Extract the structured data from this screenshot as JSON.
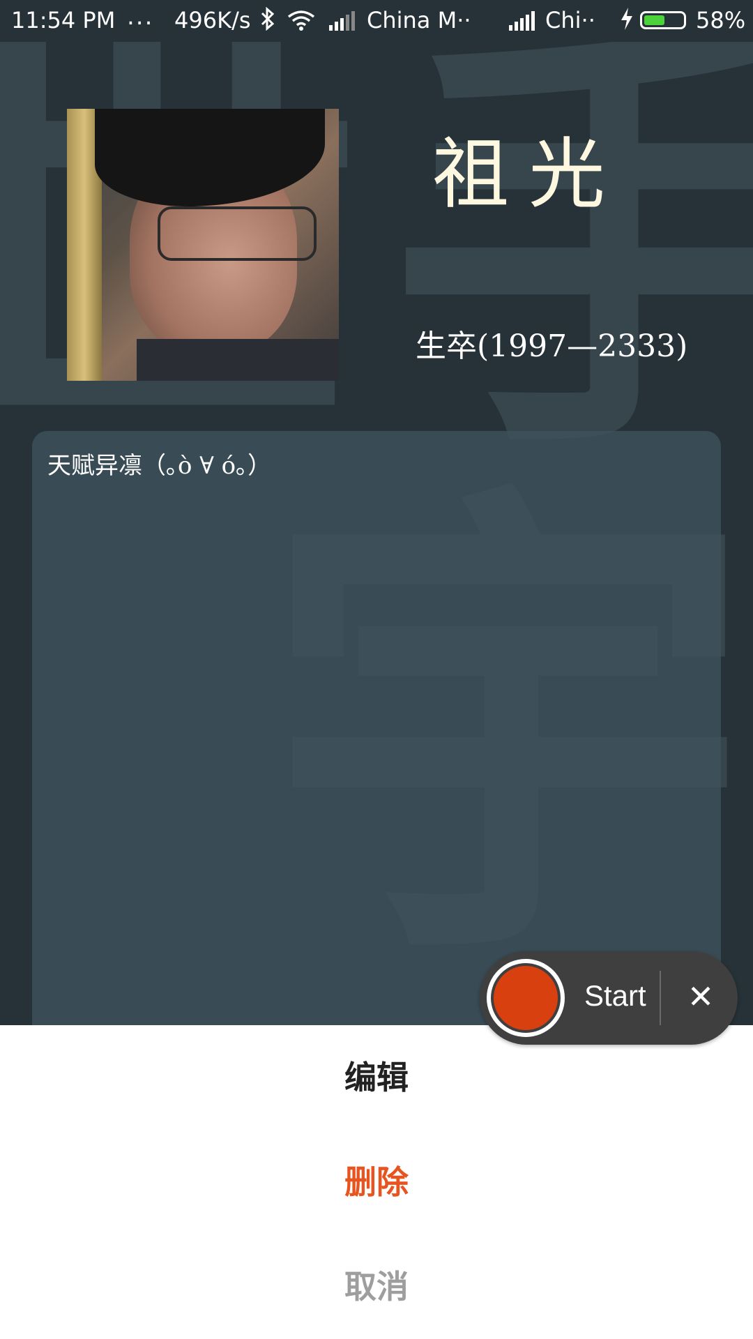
{
  "status_bar": {
    "time": "11:54 PM",
    "dots": "...",
    "speed": "496K/s",
    "carrier1": "China M··",
    "carrier2": "Chi··",
    "battery_percent": "58%",
    "battery_level": 0.58
  },
  "profile": {
    "name": "祖光",
    "life": "生卒(1997—2333)",
    "bio": "天赋异凛（｡ò ∀ ó｡）",
    "background_glyphs": [
      "世",
      "手",
      "宇"
    ]
  },
  "recorder": {
    "start_label": "Start",
    "close_symbol": "✕"
  },
  "action_sheet": {
    "edit": "编辑",
    "delete": "删除",
    "cancel": "取消"
  },
  "colors": {
    "background": "#263238",
    "delete_accent": "#e8541f",
    "record_red": "#d9400f",
    "battery_green": "#4cd23a"
  }
}
